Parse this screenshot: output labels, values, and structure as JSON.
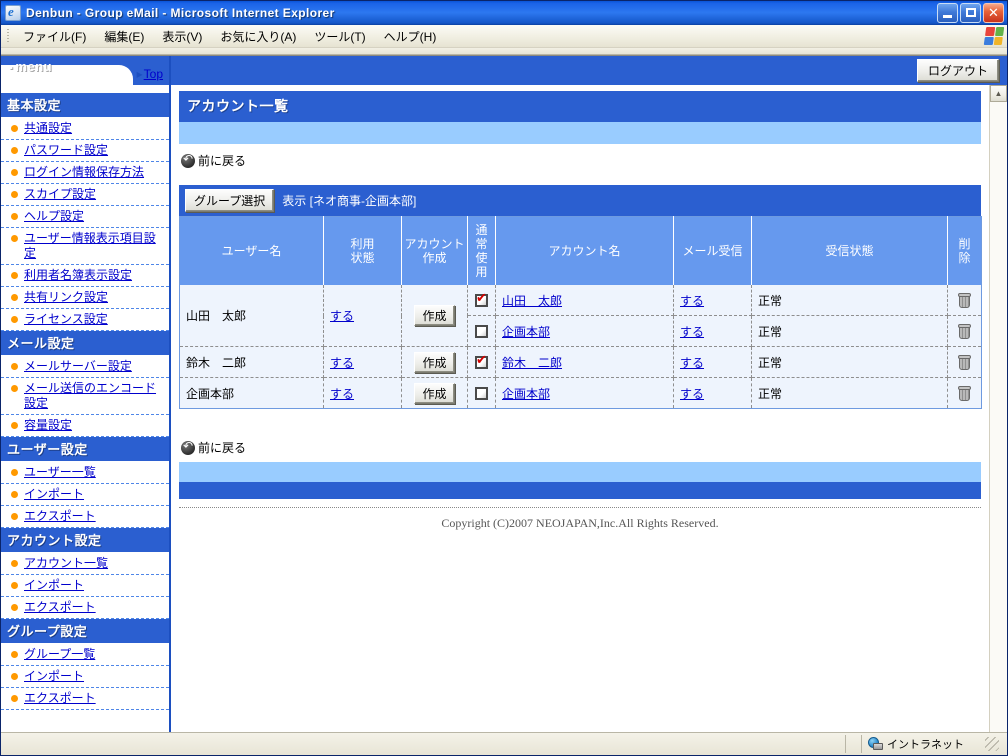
{
  "window": {
    "title": "Denbun - Group eMail - Microsoft Internet Explorer",
    "minimize_label": "",
    "maximize_label": "",
    "close_label": ""
  },
  "menubar": {
    "items": [
      {
        "label": "ファイル(F)"
      },
      {
        "label": "編集(E)"
      },
      {
        "label": "表示(V)"
      },
      {
        "label": "お気に入り(A)"
      },
      {
        "label": "ツール(T)"
      },
      {
        "label": "ヘルプ(H)"
      }
    ]
  },
  "sidebar": {
    "menu_label": "menu",
    "top_link": "Top",
    "sections": [
      {
        "title": "基本設定",
        "items": [
          {
            "label": "共通設定"
          },
          {
            "label": "パスワード設定"
          },
          {
            "label": "ログイン情報保存方法"
          },
          {
            "label": "スカイプ設定"
          },
          {
            "label": "ヘルプ設定"
          },
          {
            "label": "ユーザー情報表示項目設定"
          },
          {
            "label": "利用者名簿表示設定"
          },
          {
            "label": "共有リンク設定"
          },
          {
            "label": "ライセンス設定"
          }
        ]
      },
      {
        "title": "メール設定",
        "items": [
          {
            "label": "メールサーバー設定"
          },
          {
            "label": "メール送信のエンコード設定"
          },
          {
            "label": "容量設定"
          }
        ]
      },
      {
        "title": "ユーザー設定",
        "items": [
          {
            "label": "ユーザー一覧"
          },
          {
            "label": "インポート"
          },
          {
            "label": "エクスポート"
          }
        ]
      },
      {
        "title": "アカウント設定",
        "items": [
          {
            "label": "アカウント一覧"
          },
          {
            "label": "インポート"
          },
          {
            "label": "エクスポート"
          }
        ]
      },
      {
        "title": "グループ設定",
        "items": [
          {
            "label": "グループ一覧"
          },
          {
            "label": "インポート"
          },
          {
            "label": "エクスポート"
          }
        ]
      }
    ]
  },
  "content": {
    "logout_label": "ログアウト",
    "page_title": "アカウント一覧",
    "back_link_top": "前に戻る",
    "back_link_bottom": "前に戻る",
    "group_select_label": "グループ選択",
    "group_display_label": "表示 [ネオ商事-企画本部]",
    "copyright": "Copyright (C)2007 NEOJAPAN,Inc.All Rights Reserved.",
    "table": {
      "headers": [
        "ユーザー名",
        "利用状態",
        "アカウント作成",
        "通常使用",
        "アカウント名",
        "メール受信",
        "受信状態",
        "削除"
      ],
      "headers_wrapped": [
        [
          "ユーザー名"
        ],
        [
          "利用",
          "状態"
        ],
        [
          "アカウント",
          "作成"
        ],
        [
          "通",
          "常",
          "使",
          "用"
        ],
        [
          "アカウント名"
        ],
        [
          "メール受信"
        ],
        [
          "受信状態"
        ],
        [
          "削",
          "除"
        ]
      ],
      "users": [
        {
          "name": "山田　太郎",
          "usage_state": "する",
          "create_label": "作成",
          "accounts": [
            {
              "normal_use": true,
              "account_name": "山田　太郎",
              "mail_receive": "する",
              "receive_state": "正常",
              "delete": "delete"
            },
            {
              "normal_use": false,
              "account_name": "企画本部",
              "mail_receive": "する",
              "receive_state": "正常",
              "delete": "delete"
            }
          ]
        },
        {
          "name": "鈴木　二郎",
          "usage_state": "する",
          "create_label": "作成",
          "accounts": [
            {
              "normal_use": true,
              "account_name": "鈴木　二郎",
              "mail_receive": "する",
              "receive_state": "正常",
              "delete": "delete"
            }
          ]
        },
        {
          "name": "企画本部",
          "usage_state": "する",
          "create_label": "作成",
          "accounts": [
            {
              "normal_use": false,
              "account_name": "企画本部",
              "mail_receive": "する",
              "receive_state": "正常",
              "delete": "delete"
            }
          ]
        }
      ]
    }
  },
  "statusbar": {
    "left_text": "",
    "zone_text": "イントラネット"
  },
  "colors": {
    "accent_blue": "#2b5fd0",
    "light_blue": "#99ccff",
    "header_blue": "#6699ee",
    "row_bg": "#eef4fd",
    "link": "#0000cc",
    "bullet": "#ff9900",
    "check_red": "#d40000"
  }
}
